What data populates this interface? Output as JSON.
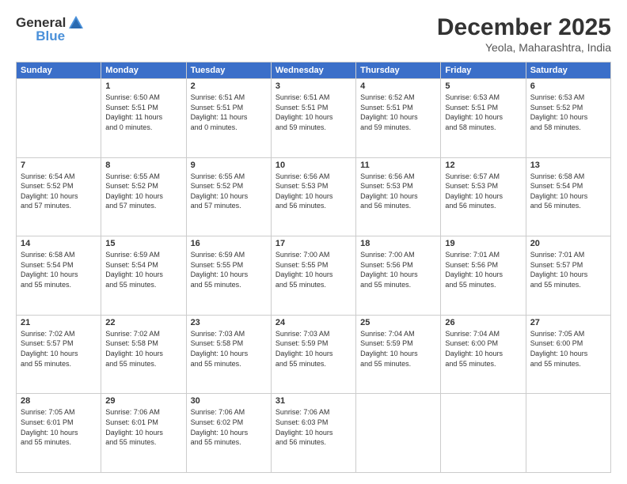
{
  "header": {
    "logo": {
      "text1": "General",
      "text2": "Blue"
    },
    "month": "December 2025",
    "location": "Yeola, Maharashtra, India"
  },
  "weekdays": [
    "Sunday",
    "Monday",
    "Tuesday",
    "Wednesday",
    "Thursday",
    "Friday",
    "Saturday"
  ],
  "weeks": [
    [
      {
        "day": "",
        "text": ""
      },
      {
        "day": "1",
        "text": "Sunrise: 6:50 AM\nSunset: 5:51 PM\nDaylight: 11 hours\nand 0 minutes."
      },
      {
        "day": "2",
        "text": "Sunrise: 6:51 AM\nSunset: 5:51 PM\nDaylight: 11 hours\nand 0 minutes."
      },
      {
        "day": "3",
        "text": "Sunrise: 6:51 AM\nSunset: 5:51 PM\nDaylight: 10 hours\nand 59 minutes."
      },
      {
        "day": "4",
        "text": "Sunrise: 6:52 AM\nSunset: 5:51 PM\nDaylight: 10 hours\nand 59 minutes."
      },
      {
        "day": "5",
        "text": "Sunrise: 6:53 AM\nSunset: 5:51 PM\nDaylight: 10 hours\nand 58 minutes."
      },
      {
        "day": "6",
        "text": "Sunrise: 6:53 AM\nSunset: 5:52 PM\nDaylight: 10 hours\nand 58 minutes."
      }
    ],
    [
      {
        "day": "7",
        "text": "Sunrise: 6:54 AM\nSunset: 5:52 PM\nDaylight: 10 hours\nand 57 minutes."
      },
      {
        "day": "8",
        "text": "Sunrise: 6:55 AM\nSunset: 5:52 PM\nDaylight: 10 hours\nand 57 minutes."
      },
      {
        "day": "9",
        "text": "Sunrise: 6:55 AM\nSunset: 5:52 PM\nDaylight: 10 hours\nand 57 minutes."
      },
      {
        "day": "10",
        "text": "Sunrise: 6:56 AM\nSunset: 5:53 PM\nDaylight: 10 hours\nand 56 minutes."
      },
      {
        "day": "11",
        "text": "Sunrise: 6:56 AM\nSunset: 5:53 PM\nDaylight: 10 hours\nand 56 minutes."
      },
      {
        "day": "12",
        "text": "Sunrise: 6:57 AM\nSunset: 5:53 PM\nDaylight: 10 hours\nand 56 minutes."
      },
      {
        "day": "13",
        "text": "Sunrise: 6:58 AM\nSunset: 5:54 PM\nDaylight: 10 hours\nand 56 minutes."
      }
    ],
    [
      {
        "day": "14",
        "text": "Sunrise: 6:58 AM\nSunset: 5:54 PM\nDaylight: 10 hours\nand 55 minutes."
      },
      {
        "day": "15",
        "text": "Sunrise: 6:59 AM\nSunset: 5:54 PM\nDaylight: 10 hours\nand 55 minutes."
      },
      {
        "day": "16",
        "text": "Sunrise: 6:59 AM\nSunset: 5:55 PM\nDaylight: 10 hours\nand 55 minutes."
      },
      {
        "day": "17",
        "text": "Sunrise: 7:00 AM\nSunset: 5:55 PM\nDaylight: 10 hours\nand 55 minutes."
      },
      {
        "day": "18",
        "text": "Sunrise: 7:00 AM\nSunset: 5:56 PM\nDaylight: 10 hours\nand 55 minutes."
      },
      {
        "day": "19",
        "text": "Sunrise: 7:01 AM\nSunset: 5:56 PM\nDaylight: 10 hours\nand 55 minutes."
      },
      {
        "day": "20",
        "text": "Sunrise: 7:01 AM\nSunset: 5:57 PM\nDaylight: 10 hours\nand 55 minutes."
      }
    ],
    [
      {
        "day": "21",
        "text": "Sunrise: 7:02 AM\nSunset: 5:57 PM\nDaylight: 10 hours\nand 55 minutes."
      },
      {
        "day": "22",
        "text": "Sunrise: 7:02 AM\nSunset: 5:58 PM\nDaylight: 10 hours\nand 55 minutes."
      },
      {
        "day": "23",
        "text": "Sunrise: 7:03 AM\nSunset: 5:58 PM\nDaylight: 10 hours\nand 55 minutes."
      },
      {
        "day": "24",
        "text": "Sunrise: 7:03 AM\nSunset: 5:59 PM\nDaylight: 10 hours\nand 55 minutes."
      },
      {
        "day": "25",
        "text": "Sunrise: 7:04 AM\nSunset: 5:59 PM\nDaylight: 10 hours\nand 55 minutes."
      },
      {
        "day": "26",
        "text": "Sunrise: 7:04 AM\nSunset: 6:00 PM\nDaylight: 10 hours\nand 55 minutes."
      },
      {
        "day": "27",
        "text": "Sunrise: 7:05 AM\nSunset: 6:00 PM\nDaylight: 10 hours\nand 55 minutes."
      }
    ],
    [
      {
        "day": "28",
        "text": "Sunrise: 7:05 AM\nSunset: 6:01 PM\nDaylight: 10 hours\nand 55 minutes."
      },
      {
        "day": "29",
        "text": "Sunrise: 7:06 AM\nSunset: 6:01 PM\nDaylight: 10 hours\nand 55 minutes."
      },
      {
        "day": "30",
        "text": "Sunrise: 7:06 AM\nSunset: 6:02 PM\nDaylight: 10 hours\nand 55 minutes."
      },
      {
        "day": "31",
        "text": "Sunrise: 7:06 AM\nSunset: 6:03 PM\nDaylight: 10 hours\nand 56 minutes."
      },
      {
        "day": "",
        "text": ""
      },
      {
        "day": "",
        "text": ""
      },
      {
        "day": "",
        "text": ""
      }
    ]
  ]
}
